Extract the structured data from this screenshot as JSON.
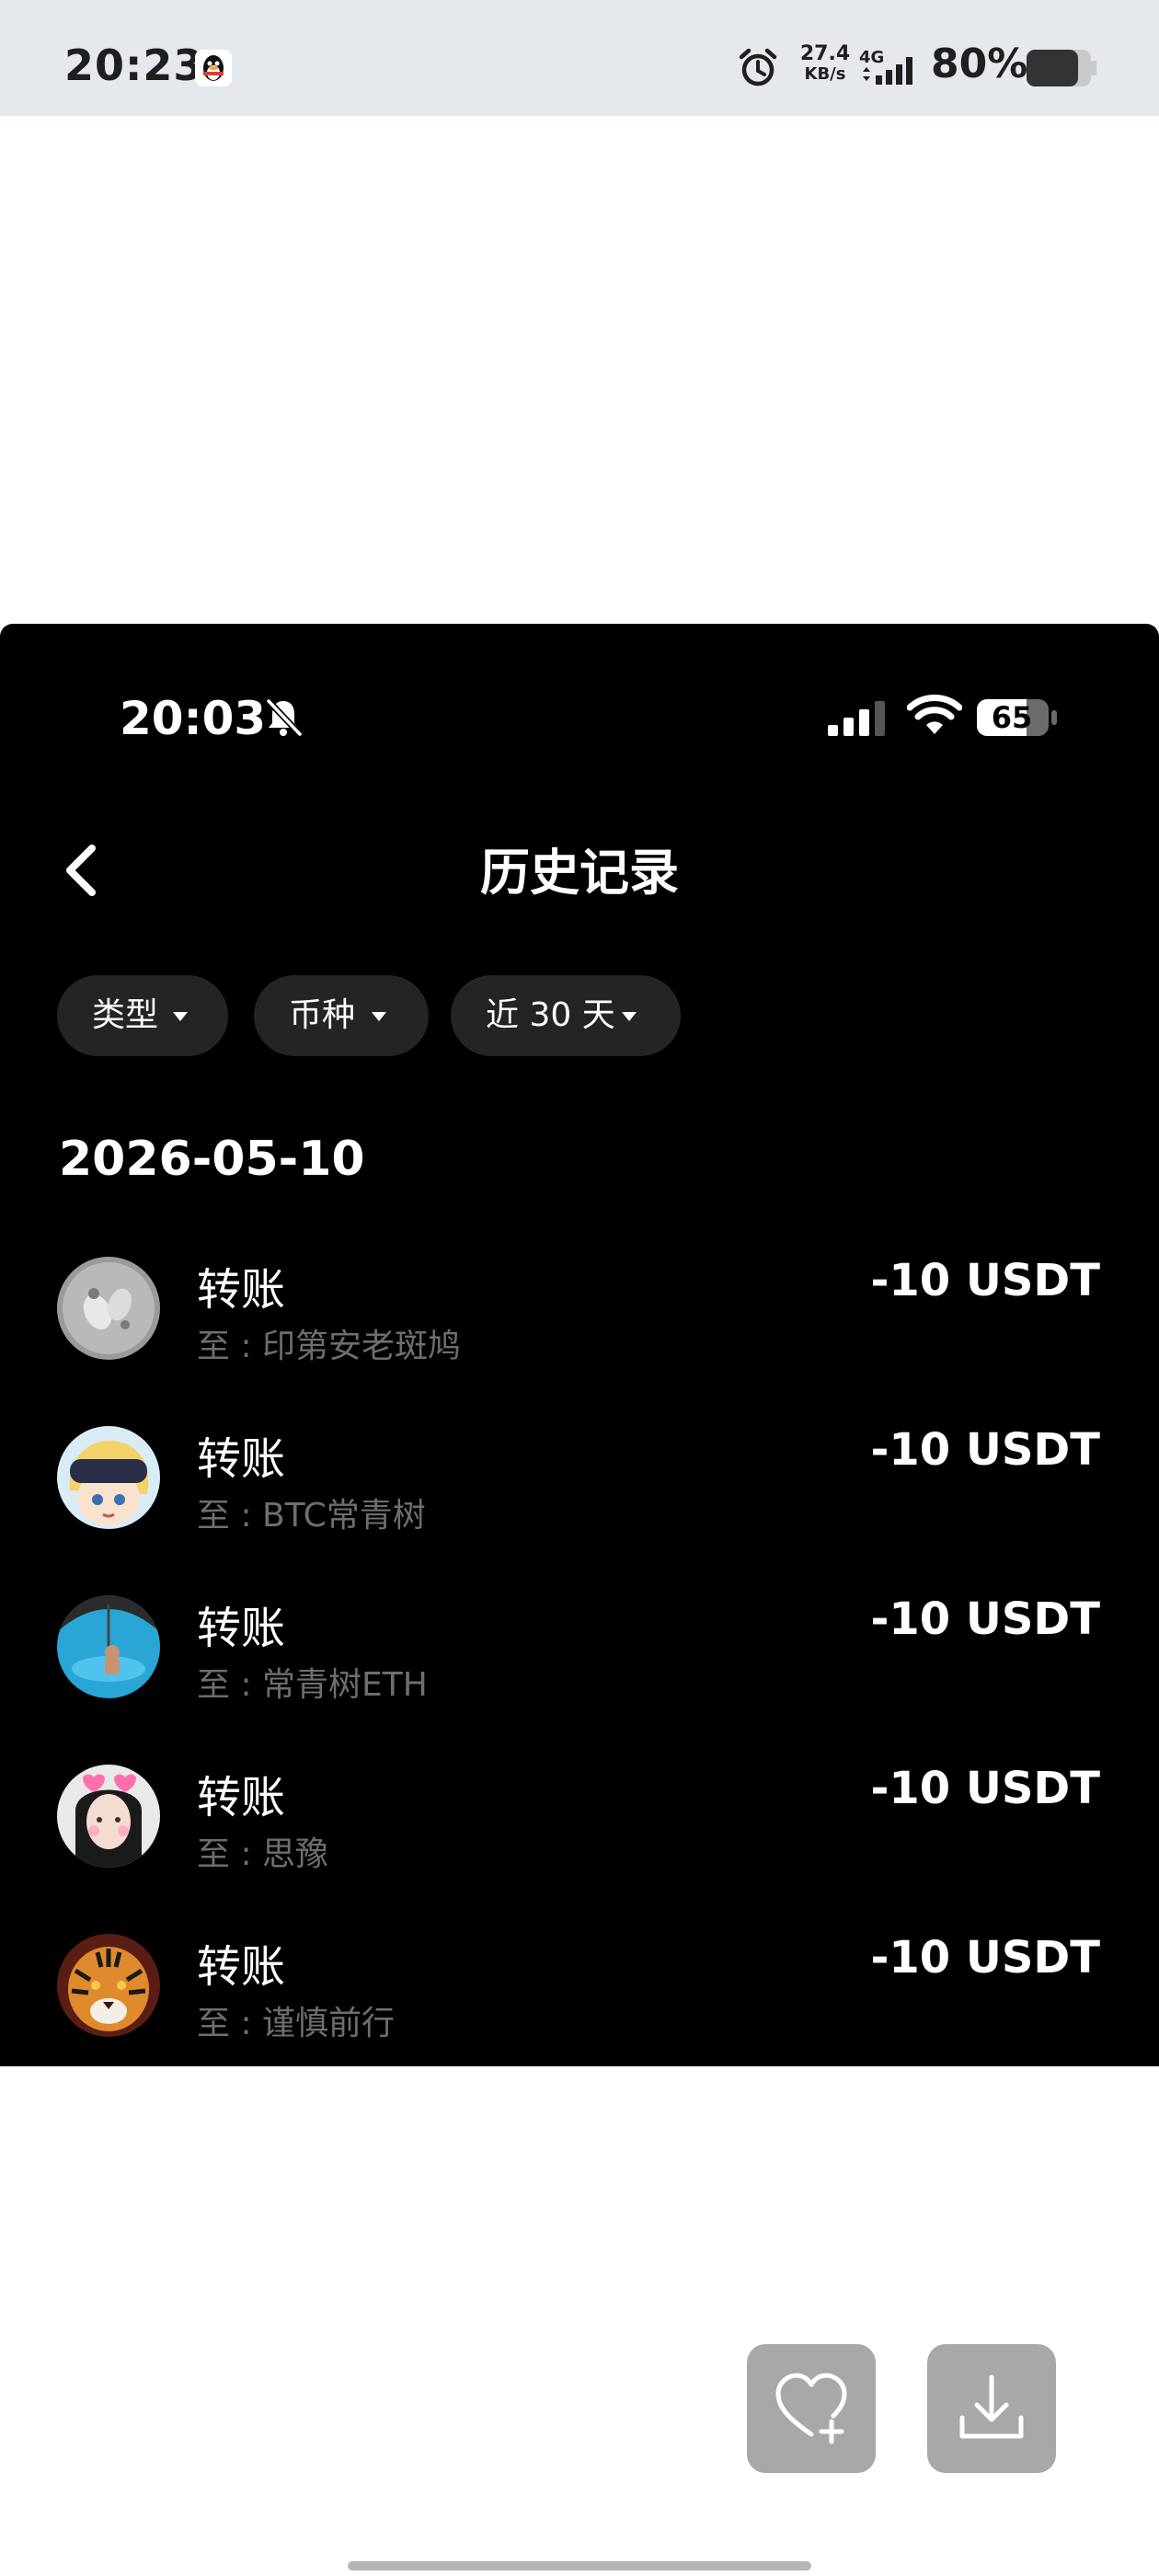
{
  "system_status": {
    "time": "20:23",
    "net_speed_value": "27.4",
    "net_speed_unit": "KB/s",
    "network_type": "4G",
    "battery_percent": "80%"
  },
  "screenshot": {
    "status": {
      "time": "20:03",
      "battery": "65"
    },
    "title": "历史记录",
    "filters": [
      {
        "label": "类型"
      },
      {
        "label": "币种"
      },
      {
        "label": "近 30 天"
      }
    ],
    "date": "2026-05-10",
    "transactions": [
      {
        "type": "转账",
        "to": "至 : 印第安老斑鸠",
        "amount": "-10 USDT",
        "avatar": "grey-doodle-avatar"
      },
      {
        "type": "转账",
        "to": "至 : BTC常青树",
        "amount": "-10 USDT",
        "avatar": "anime-vr-avatar"
      },
      {
        "type": "转账",
        "to": "至 : 常青树ETH",
        "amount": "-10 USDT",
        "avatar": "pool-umbrella-avatar"
      },
      {
        "type": "转账",
        "to": "至 : 思豫",
        "amount": "-10 USDT",
        "avatar": "girl-hearts-avatar"
      },
      {
        "type": "转账",
        "to": "至 : 谨慎前行",
        "amount": "-10 USDT",
        "avatar": "tiger-avatar"
      }
    ]
  },
  "actions": {
    "favorite_icon": "heart-plus-icon",
    "download_icon": "download-icon"
  }
}
